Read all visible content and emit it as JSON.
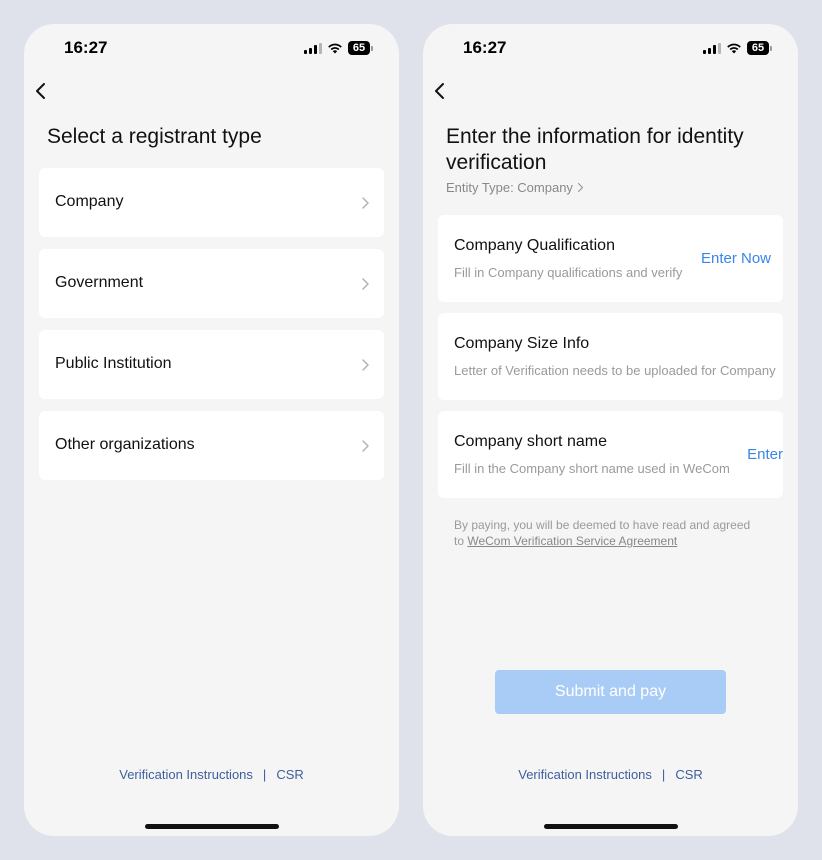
{
  "status_bar": {
    "time": "16:27",
    "battery": "65"
  },
  "left_screen": {
    "title": "Select a registrant type",
    "types": [
      {
        "label": "Company"
      },
      {
        "label": "Government"
      },
      {
        "label": "Public Institution"
      },
      {
        "label": "Other organizations"
      }
    ],
    "footer": {
      "link1": "Verification Instructions",
      "separator": "|",
      "link2": "CSR"
    }
  },
  "right_screen": {
    "title": "Enter the information for identity verification",
    "entity_type": "Entity Type: Company",
    "cards": [
      {
        "title": "Company Qualification",
        "desc": "Fill in Company qualifications and verify",
        "action": "Enter Now"
      },
      {
        "title": "Company Size Info",
        "desc": "Letter of Verification needs to be uploaded for Company",
        "action": ""
      },
      {
        "title": "Company short name",
        "desc": "Fill in the Company short name used in WeCom",
        "action": "Enter"
      }
    ],
    "agreement_prefix": "By paying, you will be deemed to have read and agreed to ",
    "agreement_link": "WeCom Verification Service Agreement",
    "submit_label": "Submit and pay",
    "footer": {
      "link1": "Verification Instructions",
      "separator": "|",
      "link2": "CSR"
    }
  },
  "colors": {
    "accent": "#3a86e8",
    "submit_disabled": "#a9ccf6",
    "link": "#3d5f9d",
    "background": "#f5f5f5"
  }
}
